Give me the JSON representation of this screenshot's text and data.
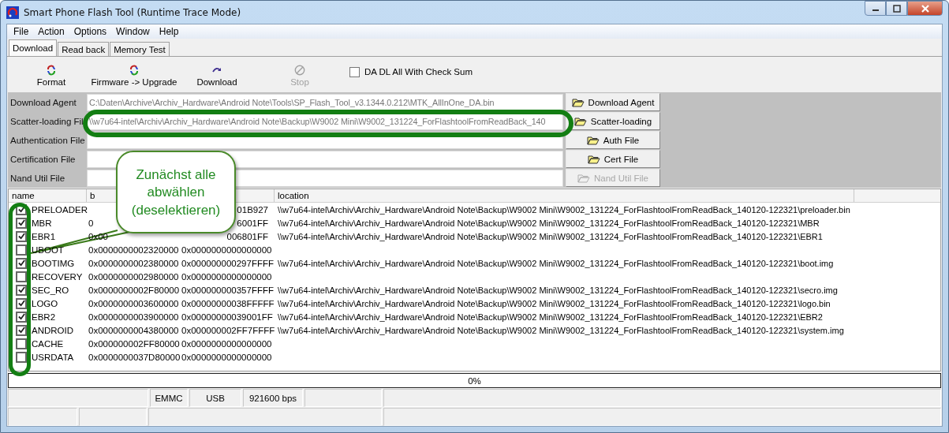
{
  "window": {
    "title": "Smart Phone Flash Tool (Runtime Trace Mode)"
  },
  "menu": [
    "File",
    "Action",
    "Options",
    "Window",
    "Help"
  ],
  "tabs": [
    {
      "label": "Download",
      "selected": true
    },
    {
      "label": "Read back",
      "selected": false
    },
    {
      "label": "Memory Test",
      "selected": false
    }
  ],
  "toolbar": [
    {
      "kind": "format",
      "label": "Format",
      "disabled": false
    },
    {
      "kind": "upgrade",
      "label": "Firmware -> Upgrade",
      "disabled": false
    },
    {
      "kind": "download",
      "label": "Download",
      "disabled": false
    },
    {
      "kind": "stop",
      "label": "Stop",
      "disabled": true
    }
  ],
  "checksum_option": {
    "label": "DA DL All With Check Sum",
    "checked": false
  },
  "files": [
    {
      "label": "Download Agent",
      "value": "C:\\Daten\\Archive\\Archiv_Hardware\\Android Note\\Tools\\SP_Flash_Tool_v3.1344.0.212\\MTK_AllInOne_DA.bin",
      "button": "Download Agent",
      "disabled": false
    },
    {
      "label": "Scatter-loading Fil",
      "value": "\\\\w7u64-intel\\Archiv\\Archiv_Hardware\\Android Note\\Backup\\W9002 Mini\\W9002_131224_ForFlashtoolFromReadBack_140",
      "button": "Scatter-loading",
      "disabled": false
    },
    {
      "label": "Authentication File",
      "button": "Auth File",
      "disabled": false
    },
    {
      "label": "Certification File",
      "button": "Cert File",
      "disabled": false
    },
    {
      "label": "Nand Util File",
      "button": "Nand Util File",
      "disabled": true
    }
  ],
  "table": {
    "columns": [
      {
        "label": "name"
      },
      {
        "label": "b"
      },
      {},
      {
        "label": "location"
      }
    ],
    "rows": [
      {
        "checked": true,
        "name": "PRELOADER",
        "column_3": "01B927",
        "location": "\\\\w7u64-intel\\Archiv\\Archiv_Hardware\\Android Note\\Backup\\W9002 Mini\\W9002_131224_ForFlashtoolFromReadBack_140120-122321\\preloader.bin"
      },
      {
        "checked": true,
        "name": "MBR",
        "column_2": "0",
        "column_3": "6001FF",
        "location": "\\\\w7u64-intel\\Archiv\\Archiv_Hardware\\Android Note\\Backup\\W9002 Mini\\W9002_131224_ForFlashtoolFromReadBack_140120-122321\\MBR"
      },
      {
        "checked": true,
        "name": "EBR1",
        "column_2": "0x00",
        "column_3": "006801FF",
        "location": "\\\\w7u64-intel\\Archiv\\Archiv_Hardware\\Android Note\\Backup\\W9002 Mini\\W9002_131224_ForFlashtoolFromReadBack_140120-122321\\EBR1"
      },
      {
        "checked": false,
        "name": "UBOOT",
        "column_2": "0x0000000002320000",
        "column_3": "0x0000000000000000"
      },
      {
        "checked": true,
        "name": "BOOTIMG",
        "column_2": "0x0000000002380000",
        "column_3": "0x000000000297FFFF",
        "location": "\\\\w7u64-intel\\Archiv\\Archiv_Hardware\\Android Note\\Backup\\W9002 Mini\\W9002_131224_ForFlashtoolFromReadBack_140120-122321\\boot.img"
      },
      {
        "checked": false,
        "name": "RECOVERY",
        "column_2": "0x0000000002980000",
        "column_3": "0x0000000000000000"
      },
      {
        "checked": true,
        "name": "SEC_RO",
        "column_2": "0x0000000002F80000",
        "column_3": "0x000000000357FFFF",
        "location": "\\\\w7u64-intel\\Archiv\\Archiv_Hardware\\Android Note\\Backup\\W9002 Mini\\W9002_131224_ForFlashtoolFromReadBack_140120-122321\\secro.img"
      },
      {
        "checked": true,
        "name": "LOGO",
        "column_2": "0x0000000003600000",
        "column_3": "0x00000000038FFFFF",
        "location": "\\\\w7u64-intel\\Archiv\\Archiv_Hardware\\Android Note\\Backup\\W9002 Mini\\W9002_131224_ForFlashtoolFromReadBack_140120-122321\\logo.bin"
      },
      {
        "checked": true,
        "name": "EBR2",
        "column_2": "0x0000000003900000",
        "column_3": "0x00000000039001FF",
        "location": "\\\\w7u64-intel\\Archiv\\Archiv_Hardware\\Android Note\\Backup\\W9002 Mini\\W9002_131224_ForFlashtoolFromReadBack_140120-122321\\EBR2"
      },
      {
        "checked": true,
        "name": "ANDROID",
        "column_2": "0x0000000004380000",
        "column_3": "0x000000002FF7FFFF",
        "location": "\\\\w7u64-intel\\Archiv\\Archiv_Hardware\\Android Note\\Backup\\W9002 Mini\\W9002_131224_ForFlashtoolFromReadBack_140120-122321\\system.img"
      },
      {
        "checked": false,
        "name": "CACHE",
        "column_2": "0x000000002FF80000",
        "column_3": "0x0000000000000000"
      },
      {
        "checked": false,
        "name": "USRDATA",
        "column_2": "0x0000000037D80000",
        "column_3": "0x0000000000000000"
      }
    ]
  },
  "progress": {
    "text": "0%",
    "level": 0
  },
  "status_bar": {
    "storage": "EMMC",
    "connection": "USB",
    "baud_rate": "921600 bps"
  },
  "annotation": {
    "text": "Zunächst alle abwählen (deselektieren)"
  }
}
